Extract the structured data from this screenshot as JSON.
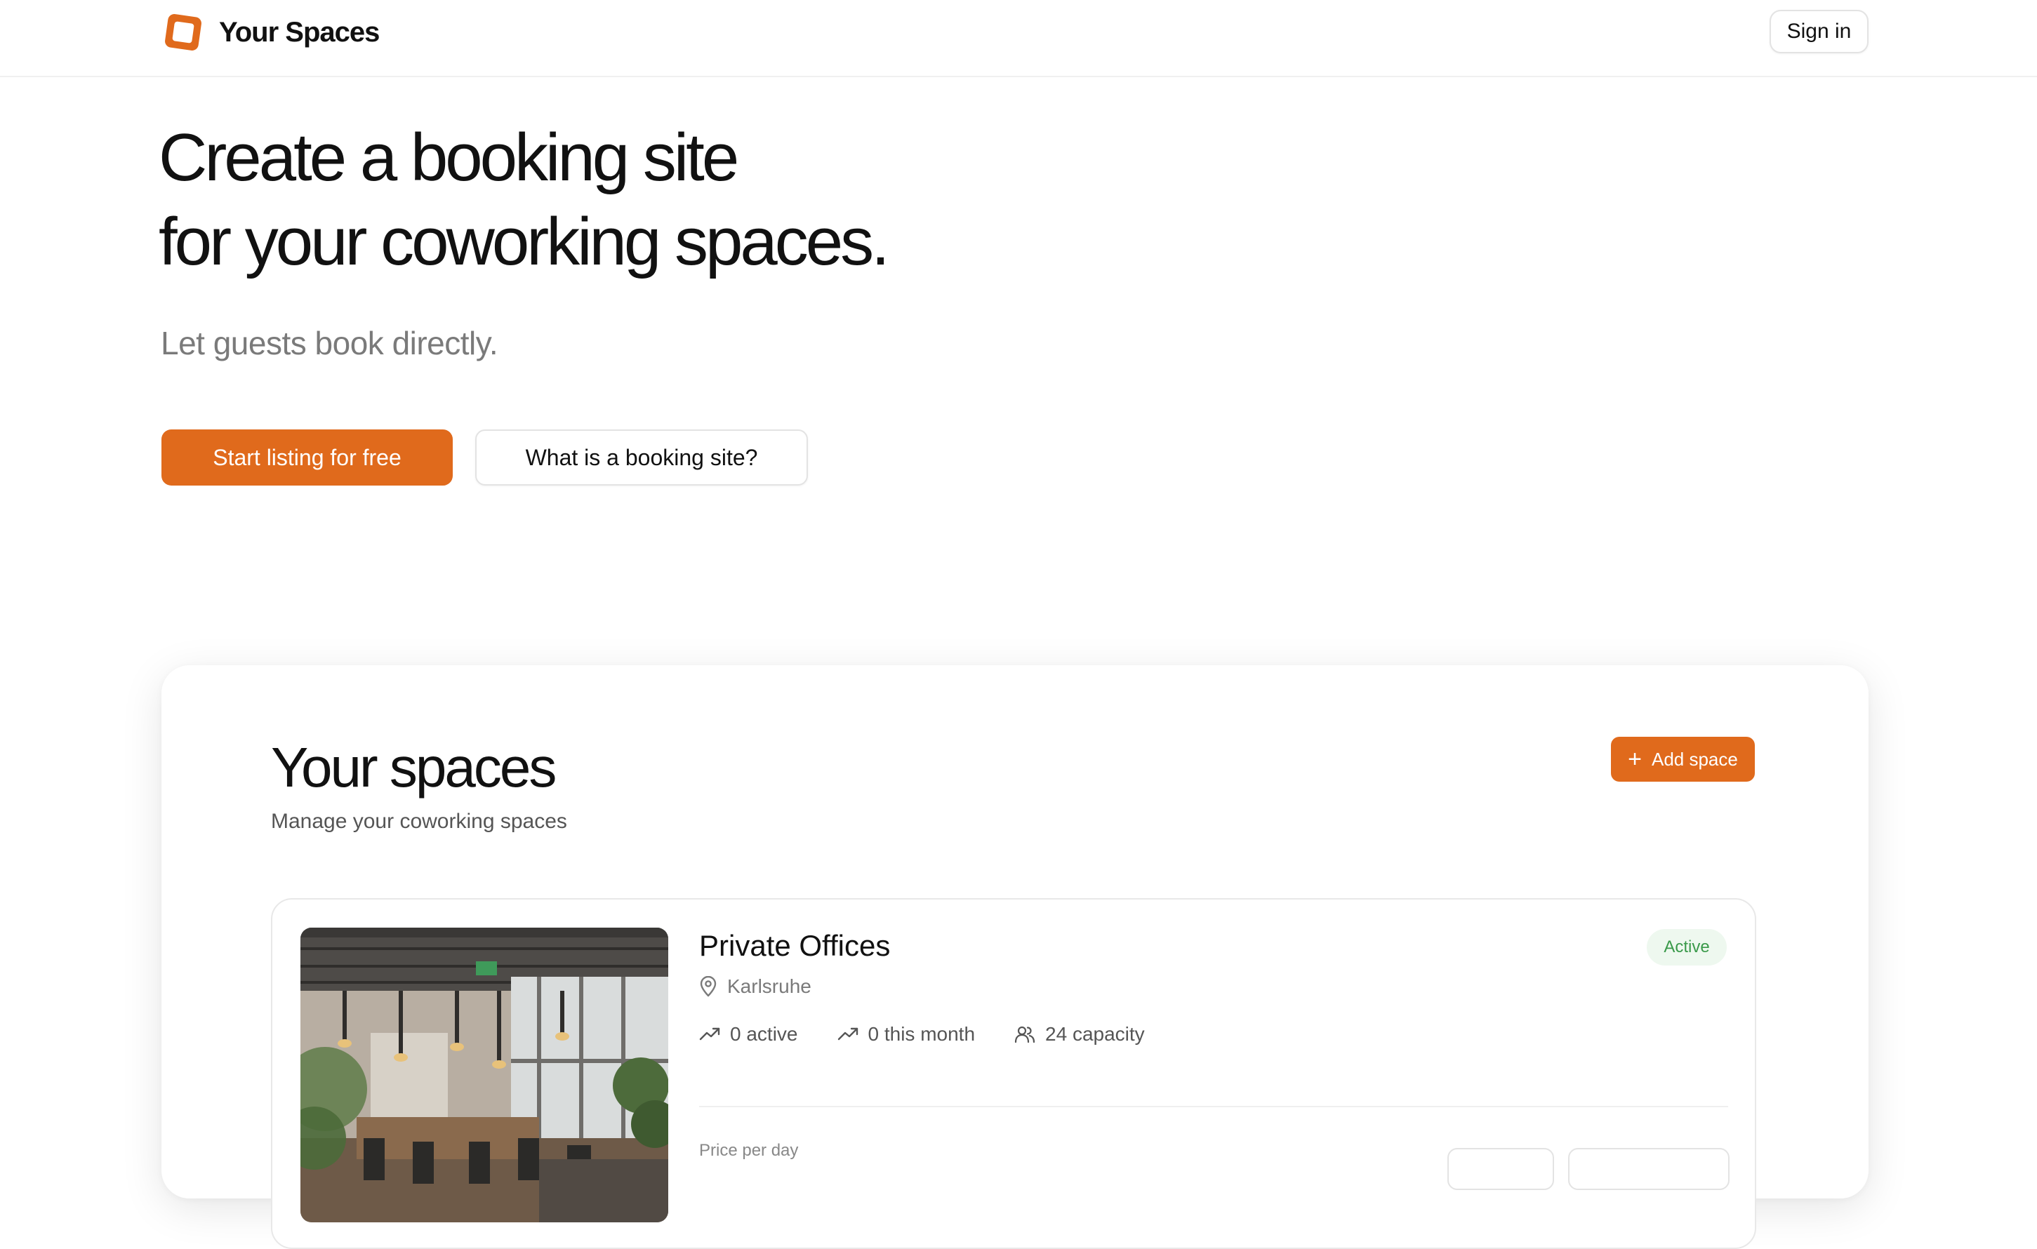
{
  "app": {
    "brand": "Your Spaces",
    "accent_color": "#e06a1c"
  },
  "header": {
    "logo_icon": "square-logo-icon",
    "signin_label": "Sign in"
  },
  "hero": {
    "title_line1": "Create a booking site",
    "title_line2": "for your coworking spaces.",
    "subtitle": "Let guests book directly.",
    "primary_cta": "Start listing for free",
    "secondary_cta": "What is a booking site?"
  },
  "spaces": {
    "title": "Your spaces",
    "subtitle": "Manage your coworking spaces",
    "add_button": "Add space",
    "add_icon": "plus-icon",
    "items": [
      {
        "name": "Private Offices",
        "location": "Karlsruhe",
        "status": "Active",
        "status_color": "#3a9a4a",
        "stats": [
          {
            "icon": "trending-up-icon",
            "label": "0 active"
          },
          {
            "icon": "trending-up-icon",
            "label": "0 this month"
          },
          {
            "icon": "users-icon",
            "label": "24 capacity"
          }
        ],
        "price_label": "Price per day"
      }
    ]
  }
}
